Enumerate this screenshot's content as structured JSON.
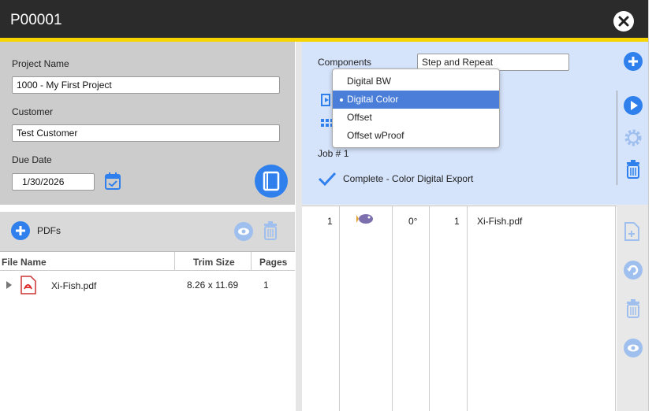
{
  "window": {
    "title": "P00001"
  },
  "project": {
    "name_label": "Project Name",
    "name_value": "1000 - My First Project",
    "customer_label": "Customer",
    "customer_value": "Test Customer",
    "due_label": "Due Date",
    "due_value": "1/30/2026"
  },
  "pdfs": {
    "title": "PDFs",
    "columns": [
      "File Name",
      "Trim Size",
      "Pages"
    ],
    "rows": [
      {
        "file": "Xi-Fish.pdf",
        "trim": "8.26 x 11.69",
        "pages": "1"
      }
    ]
  },
  "components": {
    "label": "Components",
    "selected": "Step and Repeat",
    "job": "Job # 1",
    "status": "Complete - Color Digital Export"
  },
  "dropdown": {
    "options": [
      "Digital BW",
      "Digital Color",
      "Offset",
      "Offset wProof"
    ],
    "selected_index": 1
  },
  "detail_row": {
    "col1": "1",
    "angle": "0°",
    "count": "1",
    "file": "Xi-Fish.pdf"
  },
  "colors": {
    "accent": "#2f80ed",
    "titlebar": "#2b2b2b",
    "stripe": "#f5d400",
    "panel_blue": "#d6e4fb"
  }
}
